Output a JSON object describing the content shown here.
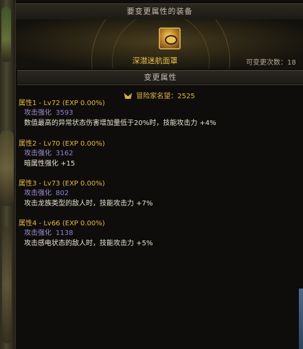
{
  "header": {
    "title": "要变更属性的装备"
  },
  "item": {
    "icon": "golden-goggles-icon",
    "name": "深潜迷航面罩",
    "change_count_label": "可变更次数：18"
  },
  "section": {
    "title": "变更属性"
  },
  "reputation": {
    "icon": "reputation-emblem-icon",
    "label": "冒险家名望：2525"
  },
  "attributes": [
    {
      "title": "属性1 - Lv72 (EXP 0.00%)",
      "stat_name": "攻击强化",
      "stat_value": "3593",
      "effect": "数值最高的异常状态伤害增加量低于20%时，技能攻击力 +4%"
    },
    {
      "title": "属性2 - Lv70 (EXP 0.00%)",
      "stat_name": "攻击强化",
      "stat_value": "3162",
      "effect": "暗属性强化 +15"
    },
    {
      "title": "属性3 - Lv73 (EXP 0.00%)",
      "stat_name": "攻击强化",
      "stat_value": "802",
      "effect": "攻击龙族类型的敌人时，技能攻击力 +7%"
    },
    {
      "title": "属性4 - Lv66 (EXP 0.00%)",
      "stat_name": "攻击强化",
      "stat_value": "1138",
      "effect": "攻击感电状态的敌人时，技能攻击力 +5%"
    }
  ],
  "colors": {
    "title_gold": "#e6b840",
    "item_name": "#e8c14a",
    "stat_purple": "#9c8fd6",
    "effect_text": "#e8e2d2",
    "panel_bg": "#0e0d0b"
  }
}
